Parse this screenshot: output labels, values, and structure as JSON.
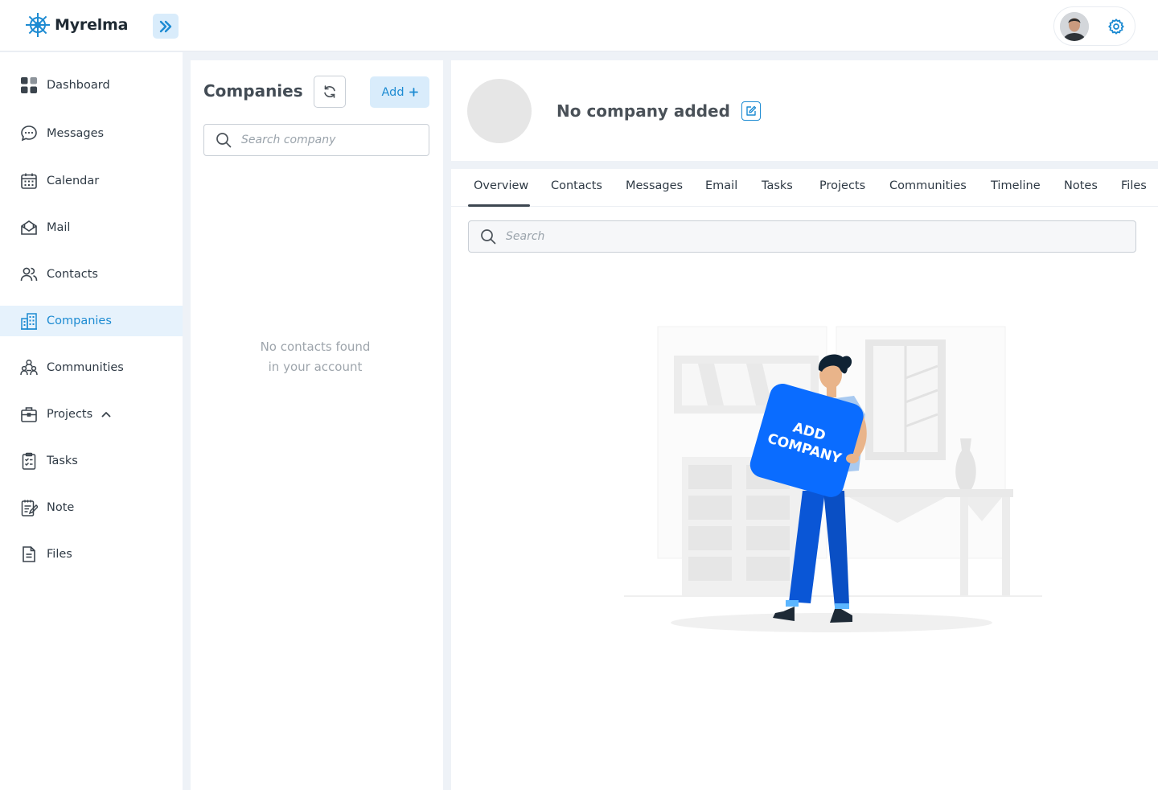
{
  "app": {
    "name": "Myrelma"
  },
  "colors": {
    "accent": "#1d8bd2",
    "accent_bg": "#d9ecfb",
    "active_bg": "#e6f2fc",
    "illustration_blue": "#0a6cff"
  },
  "sidebar": {
    "items": [
      {
        "label": "Dashboard",
        "icon": "dashboard-icon"
      },
      {
        "label": "Messages",
        "icon": "chat-bubble-icon"
      },
      {
        "label": "Calendar",
        "icon": "calendar-icon"
      },
      {
        "label": "Mail",
        "icon": "mail-icon"
      },
      {
        "label": "Contacts",
        "icon": "users-icon"
      },
      {
        "label": "Companies",
        "icon": "building-icon",
        "active": true
      },
      {
        "label": "Communities",
        "icon": "community-icon"
      },
      {
        "label": "Projects",
        "icon": "briefcase-icon",
        "expanded": true
      },
      {
        "label": "Tasks",
        "icon": "clipboard-check-icon"
      },
      {
        "label": "Note",
        "icon": "note-icon"
      },
      {
        "label": "Files",
        "icon": "file-icon"
      }
    ]
  },
  "companies_panel": {
    "title": "Companies",
    "add_label": "Add",
    "search_placeholder": "Search company",
    "empty_line1": "No contacts found",
    "empty_line2": "in your account"
  },
  "company_header": {
    "name": "No company added"
  },
  "tabs": [
    "Overview",
    "Contacts",
    "Messages",
    "Email",
    "Tasks",
    "Projects",
    "Communities",
    "Timeline",
    "Notes",
    "Files"
  ],
  "active_tab": "Overview",
  "overview": {
    "search_placeholder": "Search",
    "illustration_line1": "ADD",
    "illustration_line2": "COMPANY"
  }
}
